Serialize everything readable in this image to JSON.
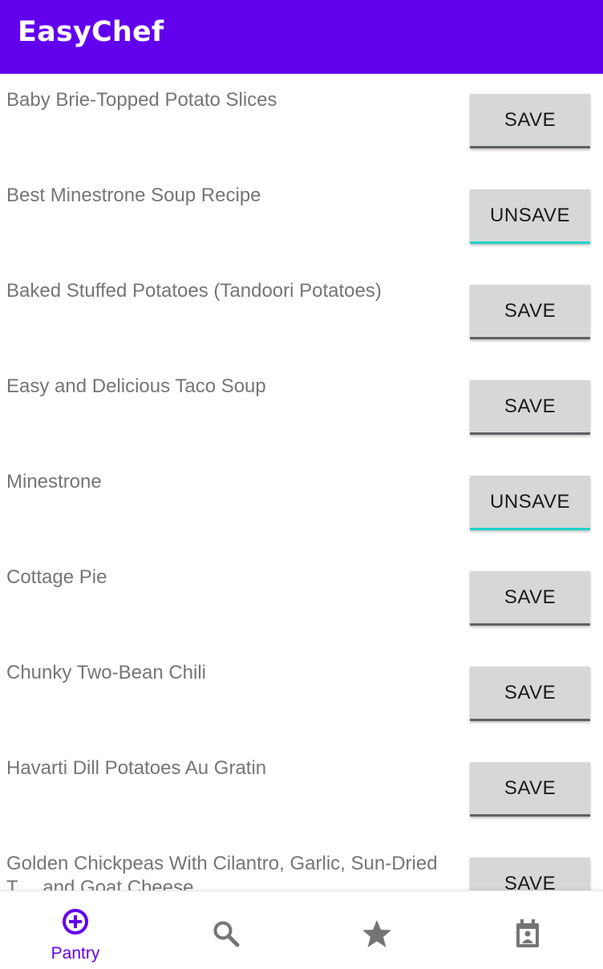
{
  "app_bar": {
    "title": "EasyChef",
    "color": "#6200ee"
  },
  "recipes": [
    {
      "title": "Baby Brie-Topped Potato Slices",
      "button": "SAVE",
      "saved": false
    },
    {
      "title": "Best Minestrone Soup Recipe",
      "button": "UNSAVE",
      "saved": true
    },
    {
      "title": "Baked Stuffed Potatoes (Tandoori Potatoes)",
      "button": "SAVE",
      "saved": false
    },
    {
      "title": "Easy and Delicious Taco Soup",
      "button": "SAVE",
      "saved": false
    },
    {
      "title": "Minestrone",
      "button": "UNSAVE",
      "saved": true
    },
    {
      "title": "Cottage Pie",
      "button": "SAVE",
      "saved": false
    },
    {
      "title": "Chunky Two-Bean Chili",
      "button": "SAVE",
      "saved": false
    },
    {
      "title": "Havarti Dill Potatoes Au Gratin",
      "button": "SAVE",
      "saved": false
    },
    {
      "title": "Golden Chickpeas With Cilantro, Garlic, Sun-Dried T… and Goat Cheese",
      "button": "SAVE",
      "saved": false
    }
  ],
  "bottom_nav": {
    "items": [
      {
        "label": "Pantry",
        "icon": "add-circle-icon",
        "active": true
      },
      {
        "label": "",
        "icon": "search-icon",
        "active": false
      },
      {
        "label": "",
        "icon": "star-icon",
        "active": false
      },
      {
        "label": "",
        "icon": "calendar-icon",
        "active": false
      }
    ],
    "active_color": "#6200ee",
    "inactive_color": "#757575"
  },
  "colors": {
    "save_underline": "#5f6062",
    "unsave_underline": "#1ad1c8",
    "button_bg": "#d6d7d7"
  }
}
